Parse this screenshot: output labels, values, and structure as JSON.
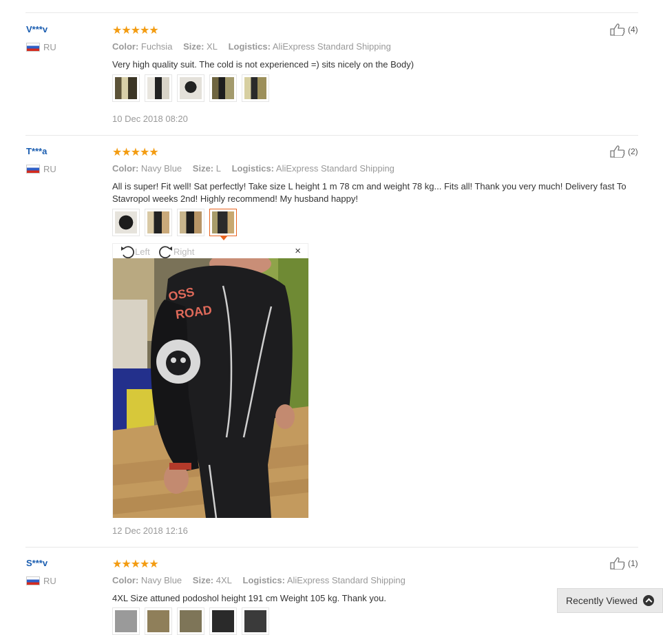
{
  "reviews": [
    {
      "user": "V***v",
      "country": "RU",
      "stars": "★★★★★",
      "likes": "(4)",
      "color_label": "Color:",
      "color": "Fuchsia",
      "size_label": "Size:",
      "size": "XL",
      "logistics_label": "Logistics:",
      "logistics": "AliExpress Standard Shipping",
      "text": "Very high quality suit. The cold is not experienced =) sits nicely on the Body)",
      "date": "10 Dec 2018 08:20"
    },
    {
      "user": "T***a",
      "country": "RU",
      "stars": "★★★★★",
      "likes": "(2)",
      "color_label": "Color:",
      "color": "Navy Blue",
      "size_label": "Size:",
      "size": "L",
      "logistics_label": "Logistics:",
      "logistics": "AliExpress Standard Shipping",
      "text": "All is super! Fit well! Sat perfectly! Take size L height 1 m 78 cm and weight 78 kg... Fits all! Thank you very much! Delivery fast To Stavropol weeks 2nd! Highly recommend! My husband happy!",
      "date": "12 Dec 2018 12:16"
    },
    {
      "user": "S***v",
      "country": "RU",
      "stars": "★★★★★",
      "likes": "(1)",
      "color_label": "Color:",
      "color": "Navy Blue",
      "size_label": "Size:",
      "size": "4XL",
      "logistics_label": "Logistics:",
      "logistics": "AliExpress Standard Shipping",
      "text": "4XL Size attuned podoshol height 191 cm Weight 105 kg. Thank you."
    }
  ],
  "viewer": {
    "rotate_left": "Left",
    "rotate_right": "Right",
    "close": "×",
    "photo_text": "OSS\nROAD"
  },
  "recently_viewed": "Recently Viewed",
  "colors": {
    "star": "#f39c12",
    "username": "#1a5db0",
    "active_thumb": "#e8631f"
  }
}
